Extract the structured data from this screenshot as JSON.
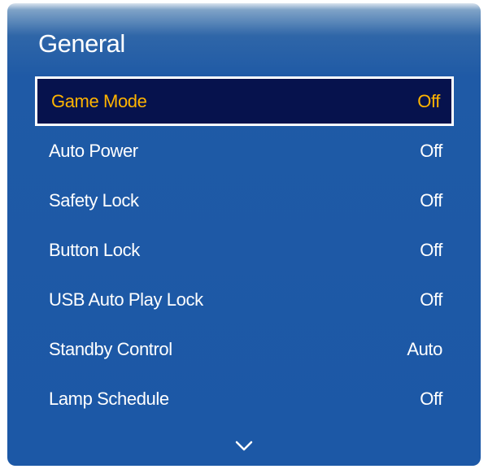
{
  "panel": {
    "title": "General"
  },
  "menu": {
    "items": [
      {
        "label": "Game Mode",
        "value": "Off",
        "selected": true
      },
      {
        "label": "Auto Power",
        "value": "Off",
        "selected": false
      },
      {
        "label": "Safety Lock",
        "value": "Off",
        "selected": false
      },
      {
        "label": "Button Lock",
        "value": "Off",
        "selected": false
      },
      {
        "label": "USB Auto Play Lock",
        "value": "Off",
        "selected": false
      },
      {
        "label": "Standby Control",
        "value": "Auto",
        "selected": false
      },
      {
        "label": "Lamp Schedule",
        "value": "Off",
        "selected": false
      }
    ]
  },
  "icons": {
    "scroll_down": "chevron-down-icon"
  },
  "colors": {
    "panel_blue": "#1c58a6",
    "selected_background": "#06124d",
    "selected_text": "#ffb400",
    "text": "#ffffff"
  }
}
